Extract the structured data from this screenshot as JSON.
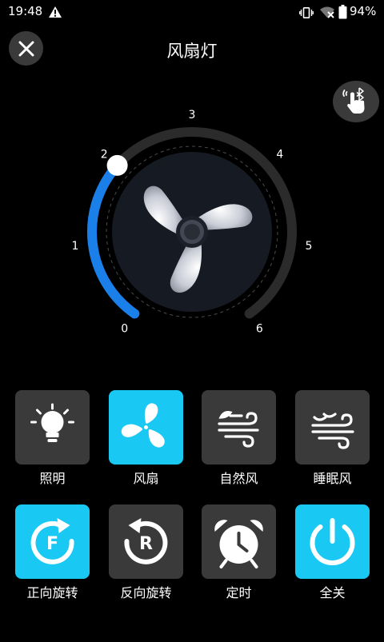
{
  "status_bar": {
    "time": "19:48",
    "battery": "94%",
    "icons": [
      "warning-icon",
      "vibrate-icon",
      "wifi-off-icon",
      "battery-icon"
    ]
  },
  "header": {
    "title": "风扇灯",
    "close_icon": "close-icon",
    "bluetooth_icon": "bluetooth-touch-icon"
  },
  "speed_dial": {
    "ticks": [
      "0",
      "1",
      "2",
      "3",
      "4",
      "5",
      "6"
    ],
    "value": 2,
    "max": 6,
    "accent_color": "#1a7fe8",
    "track_color": "#2b2b2b"
  },
  "controls": [
    {
      "label": "照明",
      "icon": "bulb-icon",
      "active": false
    },
    {
      "label": "风扇",
      "icon": "fan-icon",
      "active": true
    },
    {
      "label": "自然风",
      "icon": "natural-wind-icon",
      "active": false
    },
    {
      "label": "睡眠风",
      "icon": "sleep-wind-icon",
      "active": false
    },
    {
      "label": "正向旋转",
      "icon": "forward-rotate-icon",
      "active": true
    },
    {
      "label": "反向旋转",
      "icon": "reverse-rotate-icon",
      "active": false
    },
    {
      "label": "定时",
      "icon": "alarm-clock-icon",
      "active": false
    },
    {
      "label": "全关",
      "icon": "power-icon",
      "active": true
    }
  ],
  "colors": {
    "active_tile": "#19c8f3",
    "inactive_tile": "#3a3a3a",
    "background": "#000000"
  }
}
